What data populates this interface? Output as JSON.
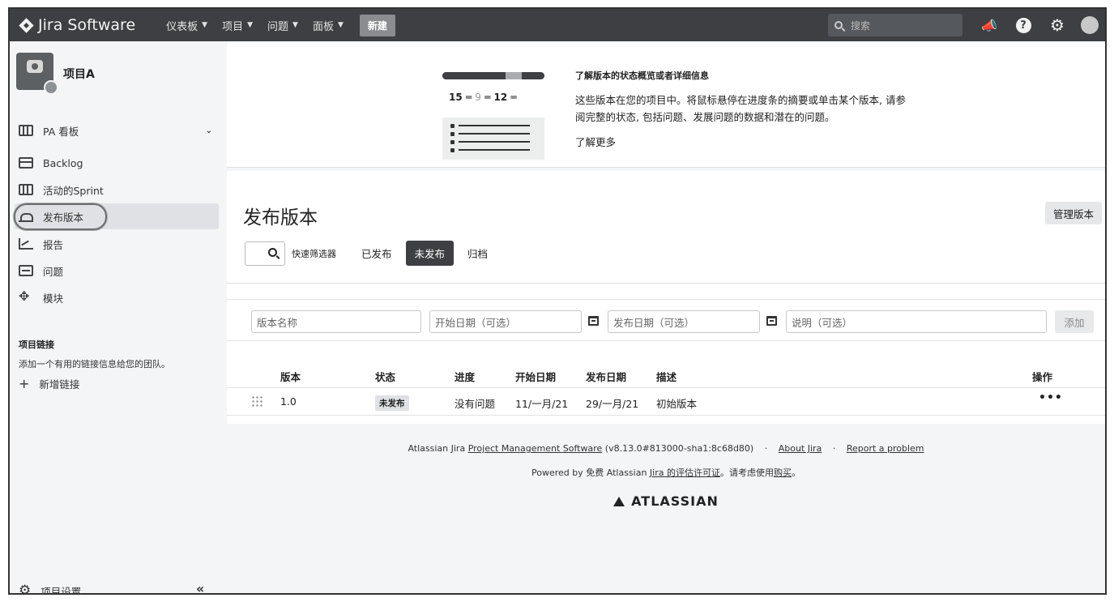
{
  "topnav": {
    "product": "Jira Software",
    "menu": [
      {
        "label": "仪表板"
      },
      {
        "label": "项目"
      },
      {
        "label": "问题"
      },
      {
        "label": "面板"
      }
    ],
    "create": "新建",
    "search_placeholder": "搜索"
  },
  "sidebar": {
    "project_name": "项目A",
    "items": [
      {
        "label": "PA 看板",
        "icon": "board-icon"
      },
      {
        "label": "Backlog",
        "icon": "backlog-icon"
      },
      {
        "label": "活动的Sprint",
        "icon": "sprint-icon"
      },
      {
        "label": "发布版本",
        "icon": "release-icon",
        "active": true
      },
      {
        "label": "报告",
        "icon": "report-icon"
      },
      {
        "label": "问题",
        "icon": "issue-icon"
      },
      {
        "label": "模块",
        "icon": "module-icon"
      }
    ],
    "links_title": "项目链接",
    "links_desc": "添加一个有用的链接信息给您的团队。",
    "add_link": "新增链接",
    "settings": "项目设置"
  },
  "banner": {
    "counts": {
      "a": "15",
      "b": "9",
      "c": "12"
    },
    "progress": {
      "done": 0.62,
      "in_progress": 0.16,
      "todo": 0.22
    },
    "title": "了解版本的状态概览或者详细信息",
    "desc": "这些版本在您的项目中。将鼠标悬停在进度条的摘要或单击某个版本, 请参阅完整的状态, 包括问题、发展问题的数据和潜在的问题。",
    "learn_more": "了解更多"
  },
  "page": {
    "title": "发布版本",
    "manage_button": "管理版本",
    "quick_filter_label": "快速筛选器",
    "tabs": [
      {
        "label": "已发布",
        "active": false
      },
      {
        "label": "未发布",
        "active": true
      },
      {
        "label": "归档",
        "active": false
      }
    ]
  },
  "form": {
    "name_placeholder": "版本名称",
    "start_placeholder": "开始日期（可选）",
    "release_placeholder": "发布日期（可选）",
    "desc_placeholder": "说明（可选）",
    "add_button": "添加"
  },
  "table": {
    "headers": {
      "version": "版本",
      "status": "状态",
      "progress": "进度",
      "start": "开始日期",
      "release": "发布日期",
      "desc": "描述",
      "actions": "操作"
    },
    "rows": [
      {
        "version": "1.0",
        "status": "未发布",
        "progress": "没有问题",
        "start": "11/一月/21",
        "release": "29/一月/21",
        "desc": "初始版本",
        "actions": "•••"
      }
    ]
  },
  "footer": {
    "line1_prefix": "Atlassian Jira",
    "line1_link": "Project Management Software",
    "version": "(v8.13.0#813000-sha1:8c68d80)",
    "about": "About Jira",
    "report": "Report a problem",
    "powered_prefix": "Powered by 免费 Atlassian",
    "powered_link": "Jira 的评估许可证",
    "powered_mid": "。请考虑使用",
    "purchase": "购买",
    "powered_end": "。",
    "brand": "ATLASSIAN"
  }
}
